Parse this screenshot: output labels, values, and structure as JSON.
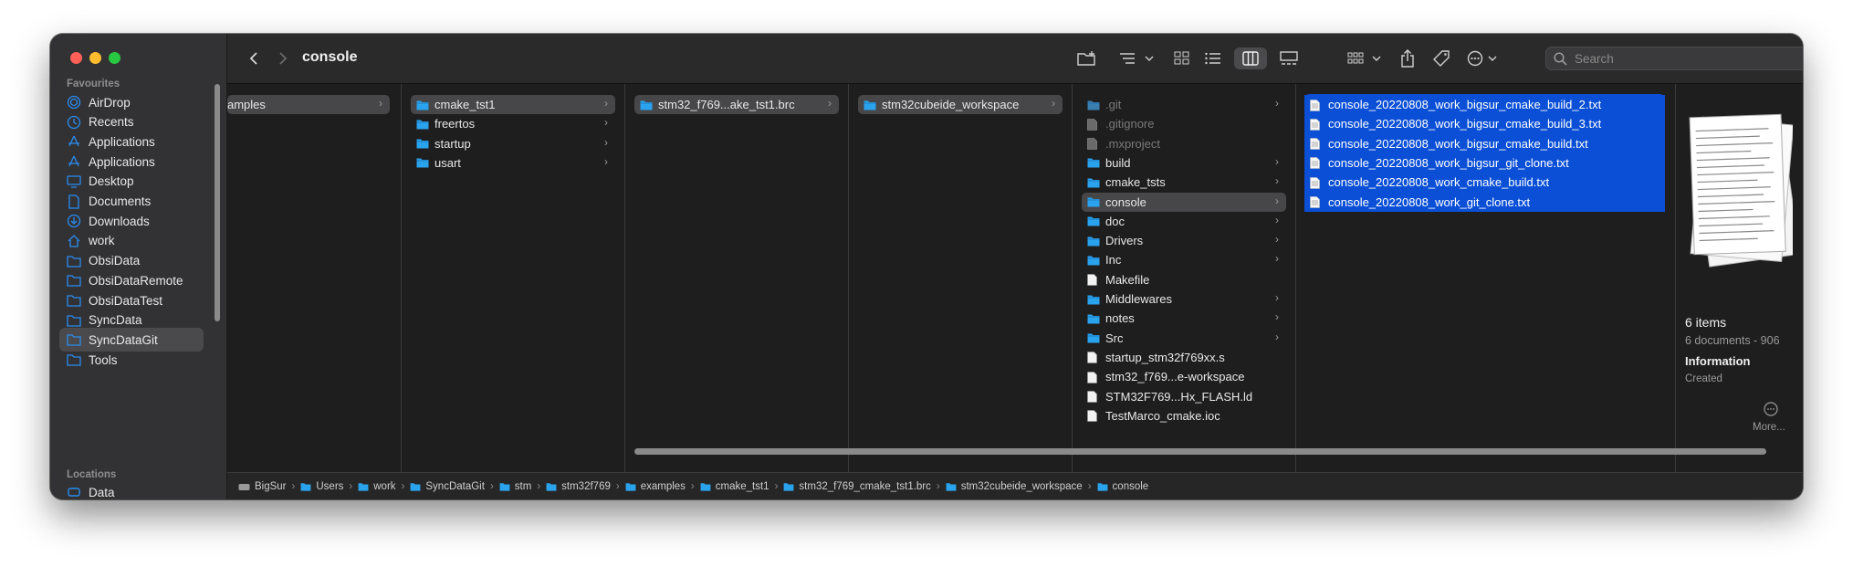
{
  "window": {
    "title": "console"
  },
  "toolbar": {
    "back_icon": "chevron-left-icon",
    "forward_icon": "chevron-right-icon",
    "search_placeholder": "Search"
  },
  "sidebar": {
    "favourites_label": "Favourites",
    "locations_label": "Locations",
    "items": [
      {
        "label": "AirDrop",
        "icon": "airdrop-icon"
      },
      {
        "label": "Recents",
        "icon": "clock-icon"
      },
      {
        "label": "Applications",
        "icon": "applications-icon"
      },
      {
        "label": "Applications",
        "icon": "applications-icon"
      },
      {
        "label": "Desktop",
        "icon": "desktop-icon"
      },
      {
        "label": "Documents",
        "icon": "document-icon"
      },
      {
        "label": "Downloads",
        "icon": "download-icon"
      },
      {
        "label": "work",
        "icon": "home-icon"
      },
      {
        "label": "ObsiData",
        "icon": "folder-icon"
      },
      {
        "label": "ObsiDataRemote",
        "icon": "folder-icon"
      },
      {
        "label": "ObsiDataTest",
        "icon": "folder-icon"
      },
      {
        "label": "SyncData",
        "icon": "folder-icon"
      },
      {
        "label": "SyncDataGit",
        "icon": "folder-icon"
      },
      {
        "label": "Tools",
        "icon": "folder-icon"
      }
    ],
    "locations_item": "Data"
  },
  "columns": {
    "col1": [
      {
        "label": "amples"
      }
    ],
    "col2": [
      {
        "label": "cmake_tst1"
      },
      {
        "label": "freertos"
      },
      {
        "label": "startup"
      },
      {
        "label": "usart"
      }
    ],
    "col3": [
      {
        "label": "stm32_f769...ake_tst1.brc"
      }
    ],
    "col4": [
      {
        "label": "stm32cubeide_workspace"
      }
    ],
    "col5": [
      {
        "label": ".git",
        "kind": "folder-dim"
      },
      {
        "label": ".gitignore",
        "kind": "file-dim"
      },
      {
        "label": ".mxproject",
        "kind": "file-dim"
      },
      {
        "label": "build",
        "kind": "folder"
      },
      {
        "label": "cmake_tsts",
        "kind": "folder"
      },
      {
        "label": "console",
        "kind": "folder"
      },
      {
        "label": "doc",
        "kind": "folder"
      },
      {
        "label": "Drivers",
        "kind": "folder"
      },
      {
        "label": "Inc",
        "kind": "folder"
      },
      {
        "label": "Makefile",
        "kind": "file"
      },
      {
        "label": "Middlewares",
        "kind": "folder"
      },
      {
        "label": "notes",
        "kind": "folder"
      },
      {
        "label": "Src",
        "kind": "folder"
      },
      {
        "label": "startup_stm32f769xx.s",
        "kind": "file"
      },
      {
        "label": "stm32_f769...e-workspace",
        "kind": "file"
      },
      {
        "label": "STM32F769...Hx_FLASH.ld",
        "kind": "file"
      },
      {
        "label": "TestMarco_cmake.ioc",
        "kind": "file"
      }
    ],
    "col6": [
      {
        "label": "console_20220808_work_bigsur_cmake_build_2.txt"
      },
      {
        "label": "console_20220808_work_bigsur_cmake_build_3.txt"
      },
      {
        "label": "console_20220808_work_bigsur_cmake_build.txt"
      },
      {
        "label": "console_20220808_work_bigsur_git_clone.txt"
      },
      {
        "label": "console_20220808_work_cmake_build.txt"
      },
      {
        "label": "console_20220808_work_git_clone.txt"
      }
    ]
  },
  "preview": {
    "count": "6 items",
    "subtitle": "6 documents - 906",
    "information": "Information",
    "created": "Created",
    "more": "More..."
  },
  "pathbar": [
    "BigSur",
    "Users",
    "work",
    "SyncDataGit",
    "stm",
    "stm32f769",
    "examples",
    "cmake_tst1",
    "stm32_f769_cmake_tst1.brc",
    "stm32cubeide_workspace",
    "console"
  ],
  "colors": {
    "selection_blue": "#0a4fd6",
    "folder_blue": "#2aa3ee",
    "close": "#fe5f57",
    "minimize": "#febc2e",
    "zoom": "#28c840"
  }
}
